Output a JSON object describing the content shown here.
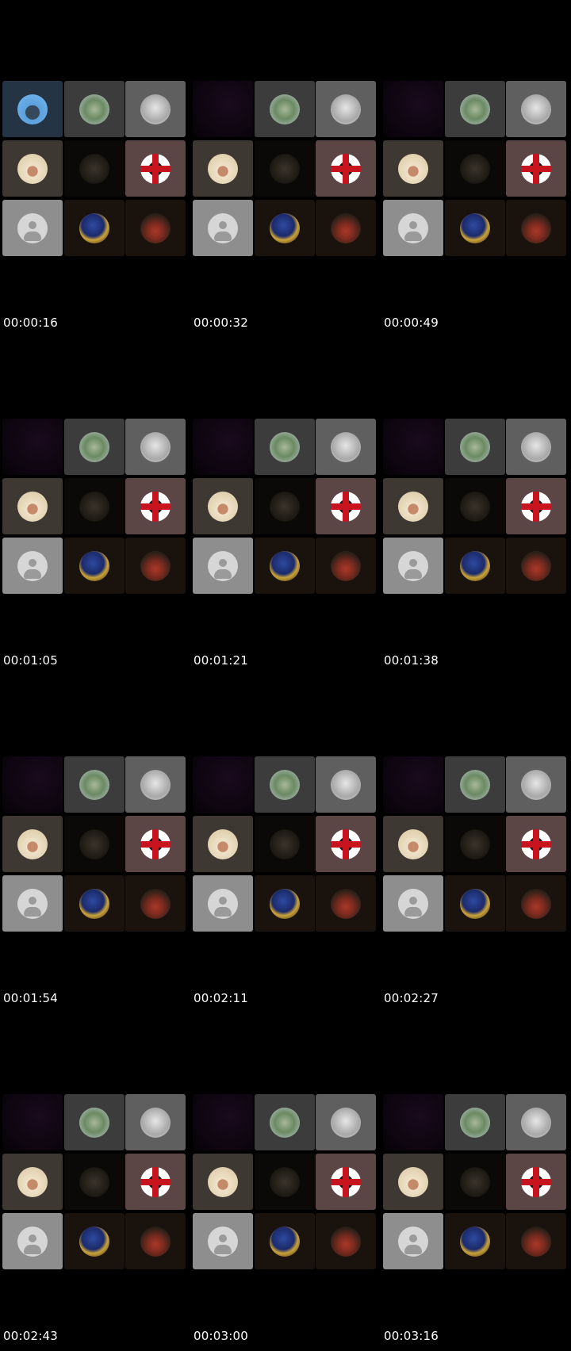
{
  "tiles": [
    {
      "name": "tile-pharaoh",
      "bg": "t-blue",
      "avatar": "av-pharaoh",
      "icon": "pharaoh-avatar-icon"
    },
    {
      "name": "tile-forest",
      "bg": "t-grey1",
      "avatar": "av-forest",
      "icon": "forest-avatar-icon"
    },
    {
      "name": "tile-sketch-face",
      "bg": "t-grey2",
      "avatar": "av-face",
      "icon": "sketch-face-avatar-icon"
    },
    {
      "name": "tile-sheep",
      "bg": "t-brown",
      "avatar": "av-sheep",
      "icon": "sheep-avatar-icon"
    },
    {
      "name": "tile-dark-text-logo",
      "bg": "t-dark",
      "avatar": "av-ink",
      "icon": "text-logo-avatar-icon"
    },
    {
      "name": "tile-red-cross",
      "bg": "t-rose",
      "avatar": "av-redcross",
      "icon": "red-cross-avatar-icon"
    },
    {
      "name": "tile-default-user",
      "bg": "t-lightgrey",
      "avatar": "av-default",
      "icon": "default-user-avatar-icon"
    },
    {
      "name": "tile-flag",
      "bg": "t-darkbrown",
      "avatar": "av-flag",
      "icon": "flag-avatar-icon"
    },
    {
      "name": "tile-portrait",
      "bg": "t-darkbrown",
      "avatar": "av-portrait",
      "icon": "portrait-avatar-icon"
    }
  ],
  "frames": [
    {
      "timestamp": "00:00:16",
      "first_tile_empty": false
    },
    {
      "timestamp": "00:00:32",
      "first_tile_empty": true
    },
    {
      "timestamp": "00:00:49",
      "first_tile_empty": true
    },
    {
      "timestamp": "00:01:05",
      "first_tile_empty": true
    },
    {
      "timestamp": "00:01:21",
      "first_tile_empty": true
    },
    {
      "timestamp": "00:01:38",
      "first_tile_empty": true
    },
    {
      "timestamp": "00:01:54",
      "first_tile_empty": true
    },
    {
      "timestamp": "00:02:11",
      "first_tile_empty": true
    },
    {
      "timestamp": "00:02:27",
      "first_tile_empty": true
    },
    {
      "timestamp": "00:02:43",
      "first_tile_empty": true
    },
    {
      "timestamp": "00:03:00",
      "first_tile_empty": true
    },
    {
      "timestamp": "00:03:16",
      "first_tile_empty": true
    }
  ]
}
